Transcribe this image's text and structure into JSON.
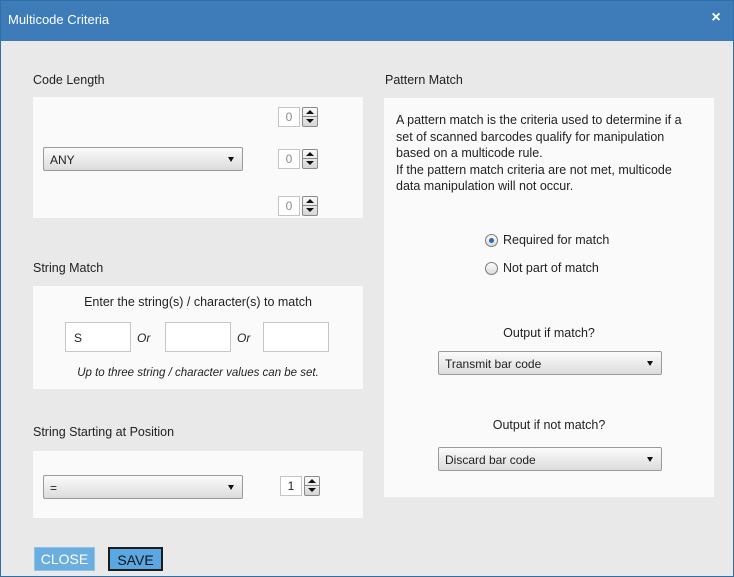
{
  "window": {
    "title": "Multicode Criteria",
    "close_glyph": "×"
  },
  "code_length": {
    "label": "Code Length",
    "select_value": "ANY",
    "spinner_values": [
      "0",
      "0",
      "0"
    ]
  },
  "string_match": {
    "label": "String Match",
    "instruction": "Enter the string(s) / character(s) to match",
    "inputs": [
      "S",
      "",
      ""
    ],
    "or_label": "Or",
    "note": "Up to three string / character values can be set."
  },
  "string_position": {
    "label": "String Starting at Position",
    "operator_value": "=",
    "position_value": "1"
  },
  "pattern_match": {
    "label": "Pattern Match",
    "description_lines": [
      "A pattern match is the criteria used to determine if a",
      "set of scanned barcodes qualify for manipulation",
      "based on a multicode rule.",
      "If the pattern match criteria are not met, multicode",
      "data manipulation will not occur."
    ],
    "radio_options": [
      "Required for match",
      "Not part of match"
    ],
    "selected_option": "Required for match",
    "output_if_match_label": "Output if match?",
    "output_if_match_value": "Transmit bar code",
    "output_if_not_match_label": "Output if not match?",
    "output_if_not_match_value": "Discard bar code"
  },
  "footer": {
    "close_label": "CLOSE",
    "save_label": "SAVE"
  },
  "colors": {
    "titlebar": "#3d7cb8",
    "background": "#e9e9e9",
    "panel": "#fafafa",
    "accent_button": "#5aa8e3",
    "radio_selected": "#2c6bb8"
  }
}
